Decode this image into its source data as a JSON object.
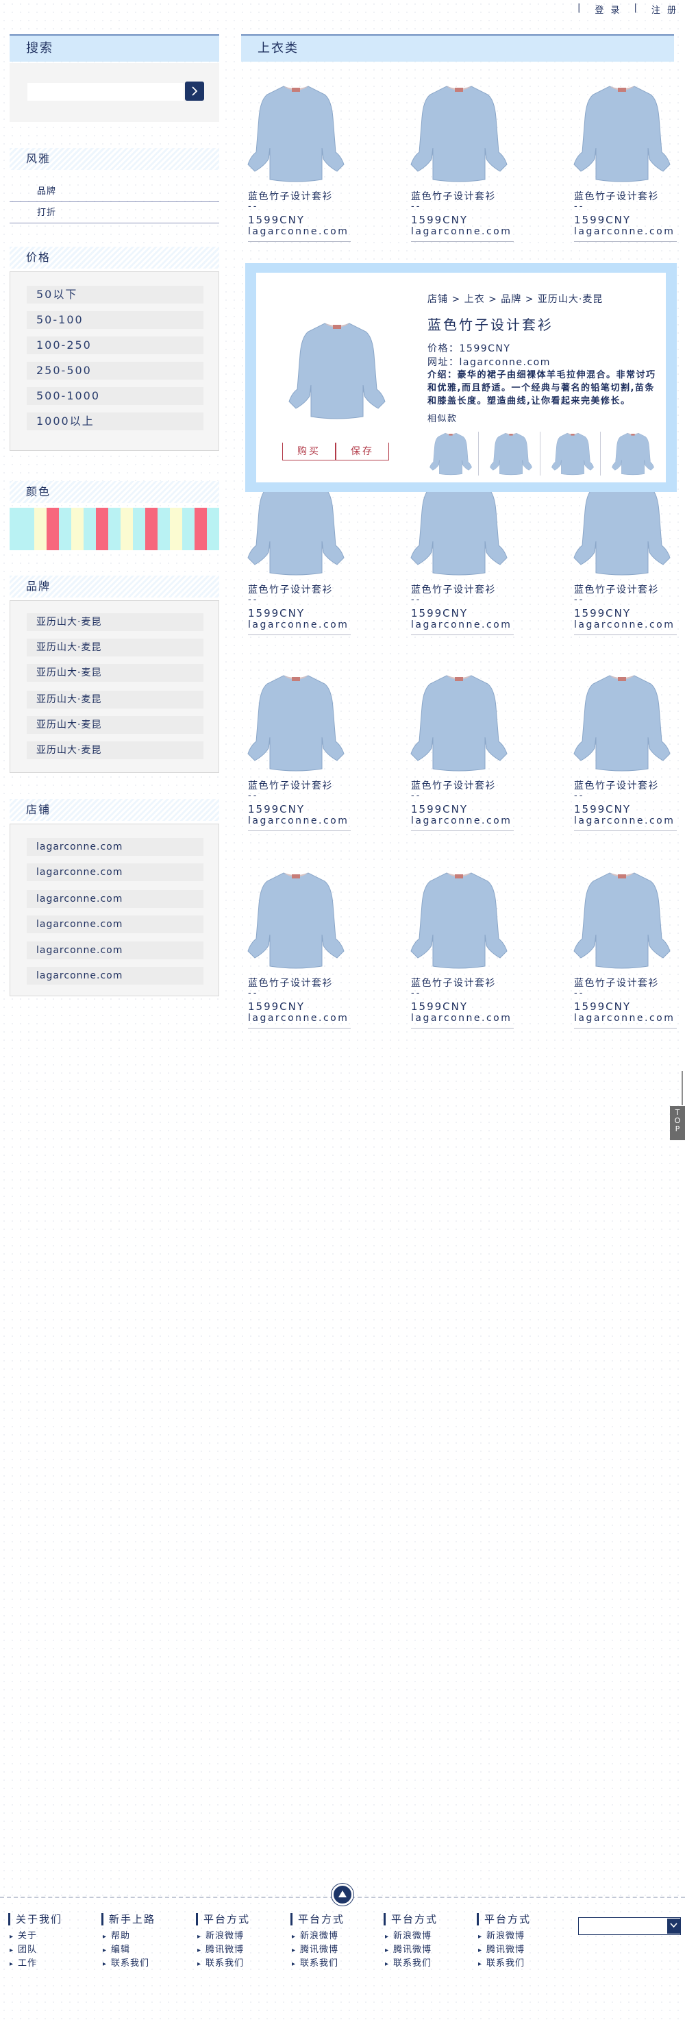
{
  "topbar": {
    "login": "登 录",
    "sep1": "|",
    "sep2": "|",
    "register": "注 册"
  },
  "sidebar": {
    "search": {
      "title": "搜索",
      "placeholder": "",
      "button_icon": "chevron-right-icon"
    },
    "style": {
      "title": "风雅",
      "items": [
        "品牌",
        "打折"
      ]
    },
    "price": {
      "title": "价格",
      "items": [
        "50以下",
        "50-100",
        "100-250",
        "250-500",
        "500-1000",
        "1000以上"
      ]
    },
    "color": {
      "title": "颜色",
      "stripes": [
        "#b9f2f3",
        "#b9f2f3",
        "#fbfbd1",
        "#f7677d",
        "#b9f2f3",
        "#fbfbd1",
        "#b9f2f3",
        "#f7677d",
        "#b9f2f3",
        "#fbfbd1",
        "#b9f2f3",
        "#f7677d",
        "#b9f2f3",
        "#fbfbd1",
        "#b9f2f3",
        "#f7677d",
        "#b9f2f3"
      ]
    },
    "brand": {
      "title": "品牌",
      "items": [
        "亚历山大·麦昆",
        "亚历山大·麦昆",
        "亚历山大·麦昆",
        "亚历山大·麦昆",
        "亚历山大·麦昆",
        "亚历山大·麦昆"
      ]
    },
    "shop": {
      "title": "店铺",
      "items": [
        "lagarconne.com",
        "lagarconne.com",
        "lagarconne.com",
        "lagarconne.com",
        "lagarconne.com",
        "lagarconne.com"
      ]
    }
  },
  "main": {
    "title": "上衣类",
    "product": {
      "name": "蓝色竹子设计套衫",
      "sub": "--",
      "price": "1599CNY",
      "url": "lagarconne.com"
    }
  },
  "detail": {
    "breadcrumb": "店铺 > 上衣 > 品牌 > 亚历山大·麦昆",
    "title": "蓝色竹子设计套衫",
    "price": "价格：1599CNY",
    "url": "网址：lagarconne.com",
    "desc": "介绍：豪华的裙子由细裸体羊毛拉伸混合。非常讨巧和优雅,而且舒适。一个经典与著名的铅笔切割,苗条和膝盖长度。塑造曲线,让你看起来完美修长。",
    "similar": "相似款",
    "buy": "购买",
    "save": "保存"
  },
  "toptab": "TOP",
  "footer": {
    "columns": [
      {
        "title": "关于我们",
        "items": [
          "关于",
          "团队",
          "工作"
        ]
      },
      {
        "title": "新手上路",
        "items": [
          "帮助",
          "编辑",
          "联系我们"
        ]
      },
      {
        "title": "平台方式",
        "items": [
          "新浪微博",
          "腾讯微博",
          "联系我们"
        ]
      },
      {
        "title": "平台方式",
        "items": [
          "新浪微博",
          "腾讯微博",
          "联系我们"
        ]
      },
      {
        "title": "平台方式",
        "items": [
          "新浪微博",
          "腾讯微博",
          "联系我们"
        ]
      },
      {
        "title": "平台方式",
        "items": [
          "新浪微博",
          "腾讯微博",
          "联系我们"
        ]
      }
    ]
  },
  "colors": {
    "navy": "#1d3567",
    "header_bg": "#d3e9fb",
    "popup_bg": "#bfe0fb",
    "accent_red": "#b23a48"
  }
}
